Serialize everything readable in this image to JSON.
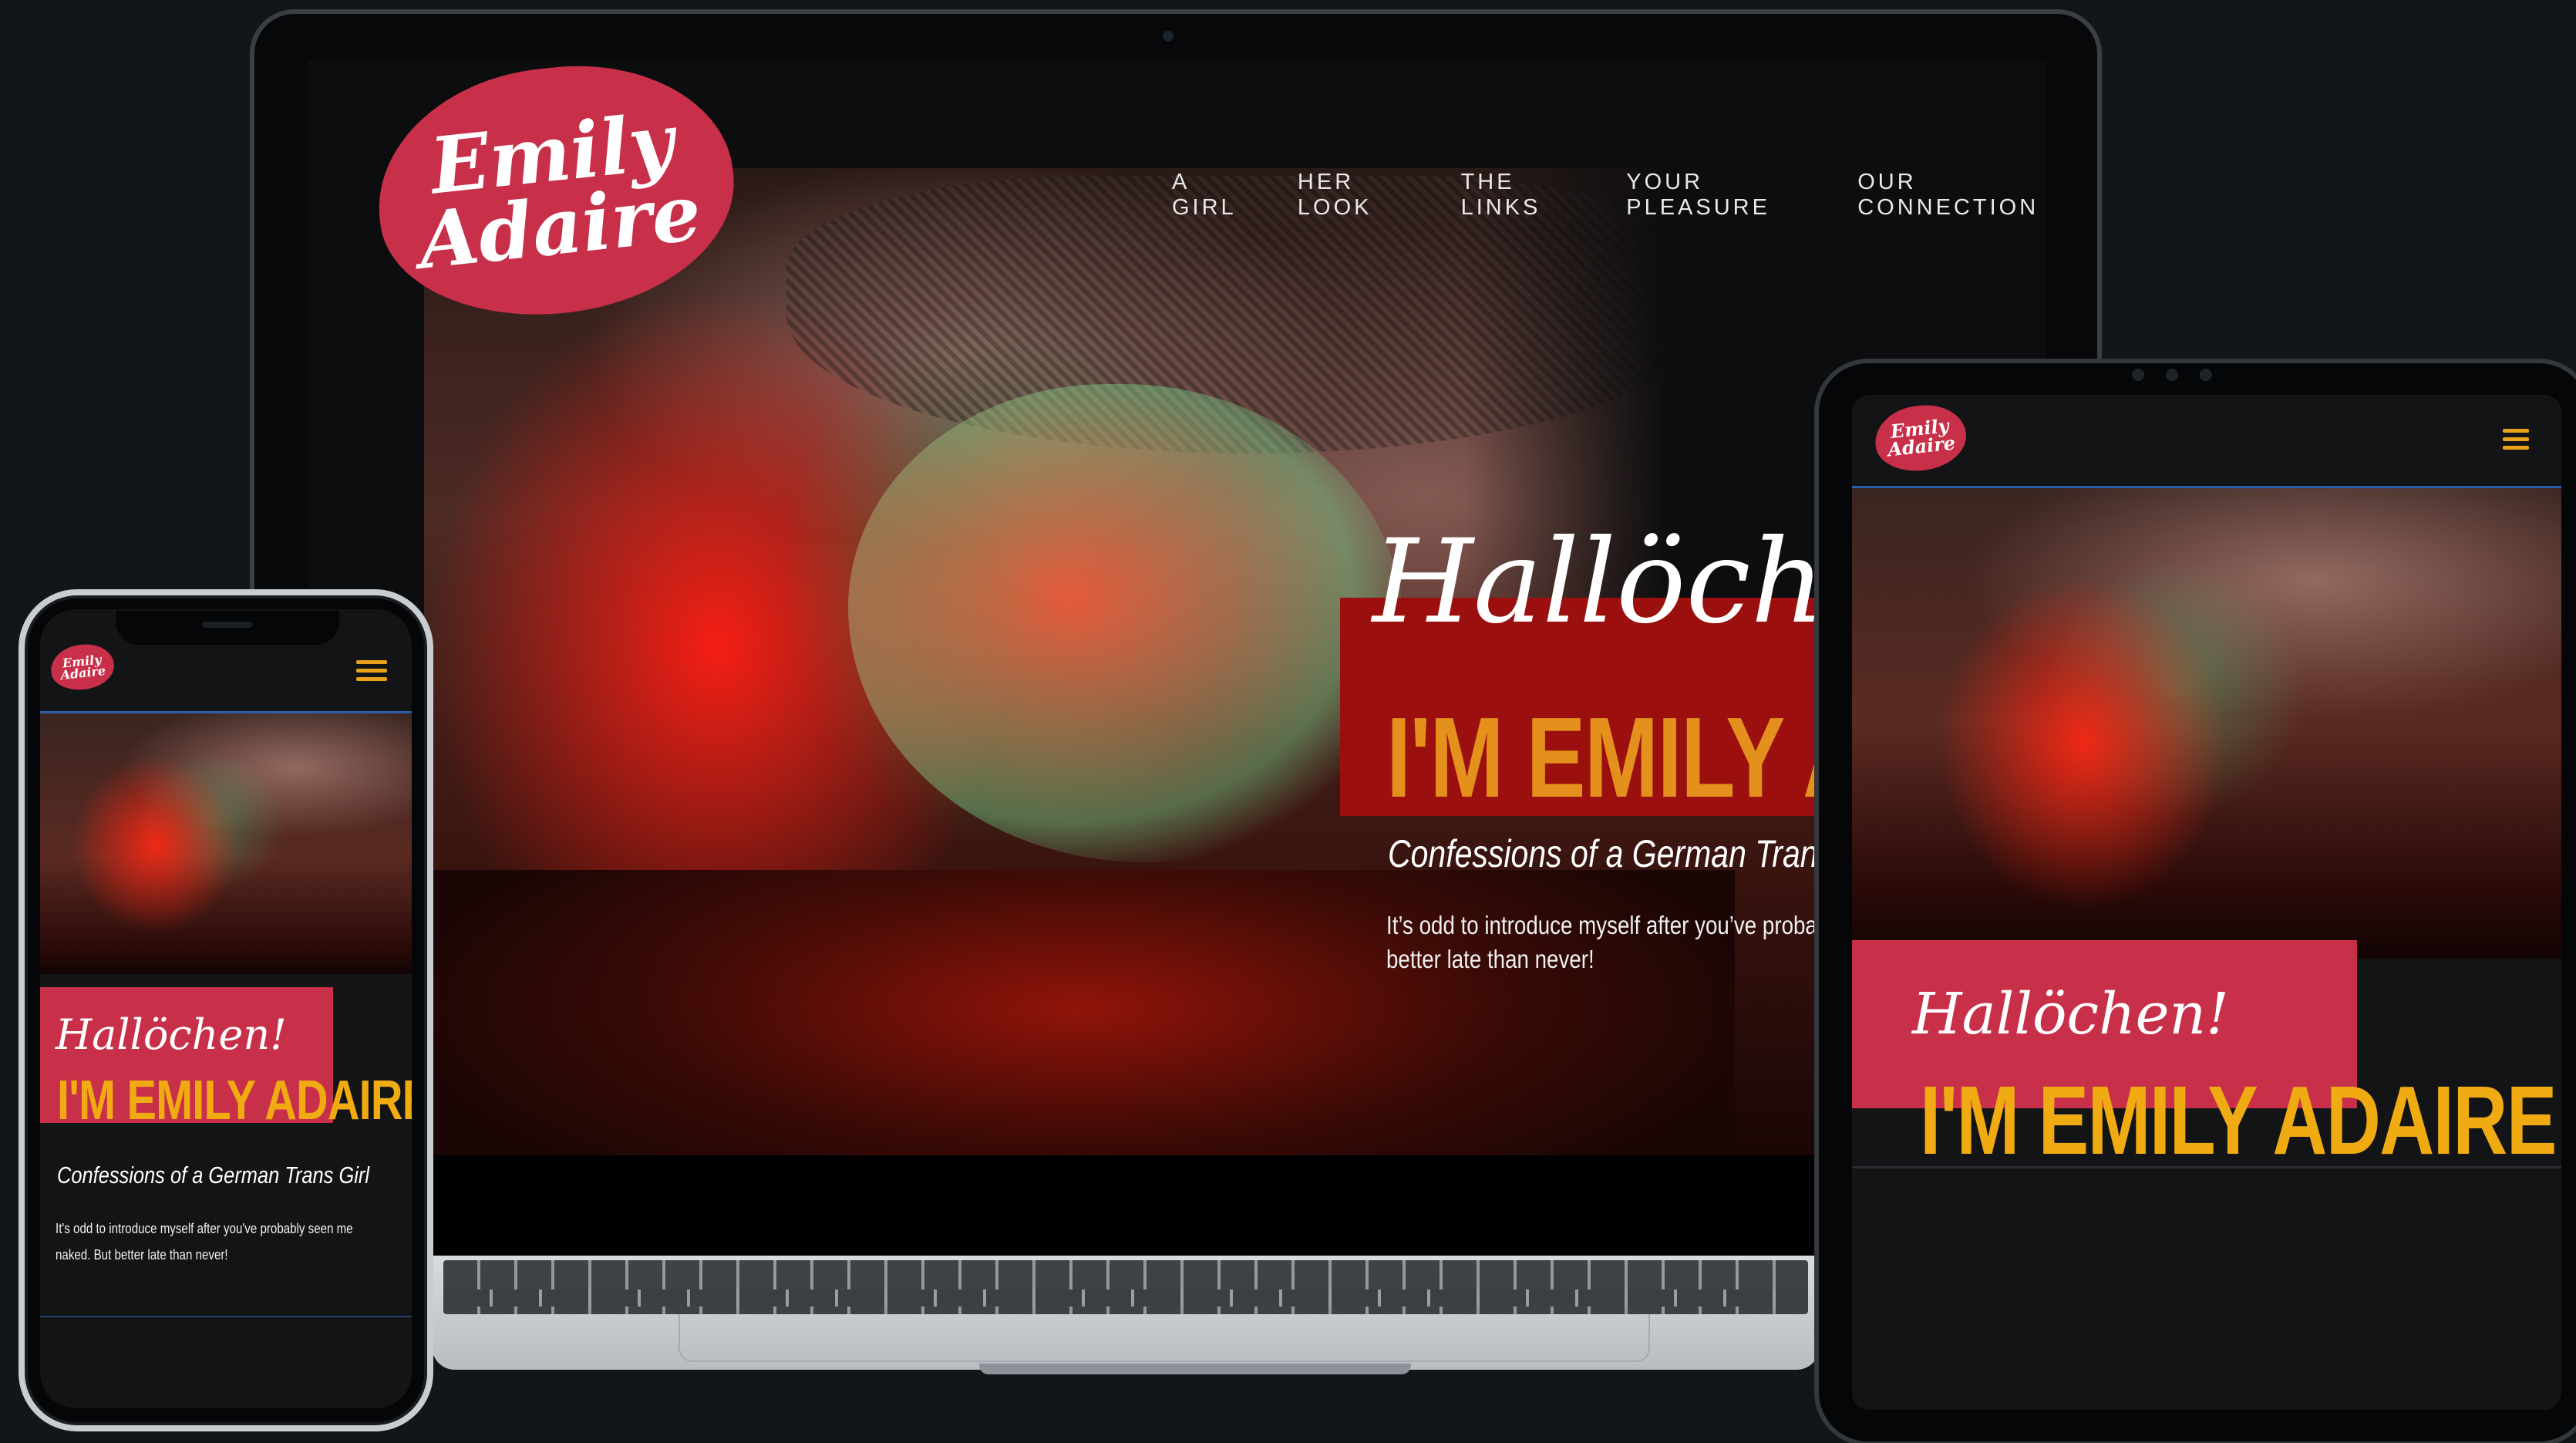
{
  "brand": {
    "logo_line1": "Emily",
    "logo_line2": "Adaire",
    "accent_red": "#c8304a",
    "accent_gold": "#f0ab12",
    "hero_box_red": "#9c0f0f"
  },
  "laptop": {
    "nav": [
      "A GIRL",
      "HER LOOK",
      "THE LINKS",
      "YOUR PLEASURE",
      "OUR CONNECTION"
    ],
    "hero": {
      "greeting": "Hallöchen!",
      "name": "I'M EMILY AI",
      "tagline": "Confessions of a German Tran",
      "intro_line1": "It’s odd to introduce myself after you’ve proba",
      "intro_line2": "better late than never!"
    }
  },
  "tablet": {
    "menu_icon": "hamburger-icon",
    "hero": {
      "greeting": "Hallöchen!",
      "name": "I'M EMILY ADAIRE"
    }
  },
  "phone": {
    "menu_icon": "hamburger-icon",
    "hero": {
      "greeting": "Hallöchen!",
      "name": "I'M EMILY ADAIRE",
      "tagline": "Confessions of a German Trans Girl",
      "intro_line1": "It's odd to introduce myself after you've probably seen me",
      "intro_line2": "naked. But better late than never!"
    }
  }
}
